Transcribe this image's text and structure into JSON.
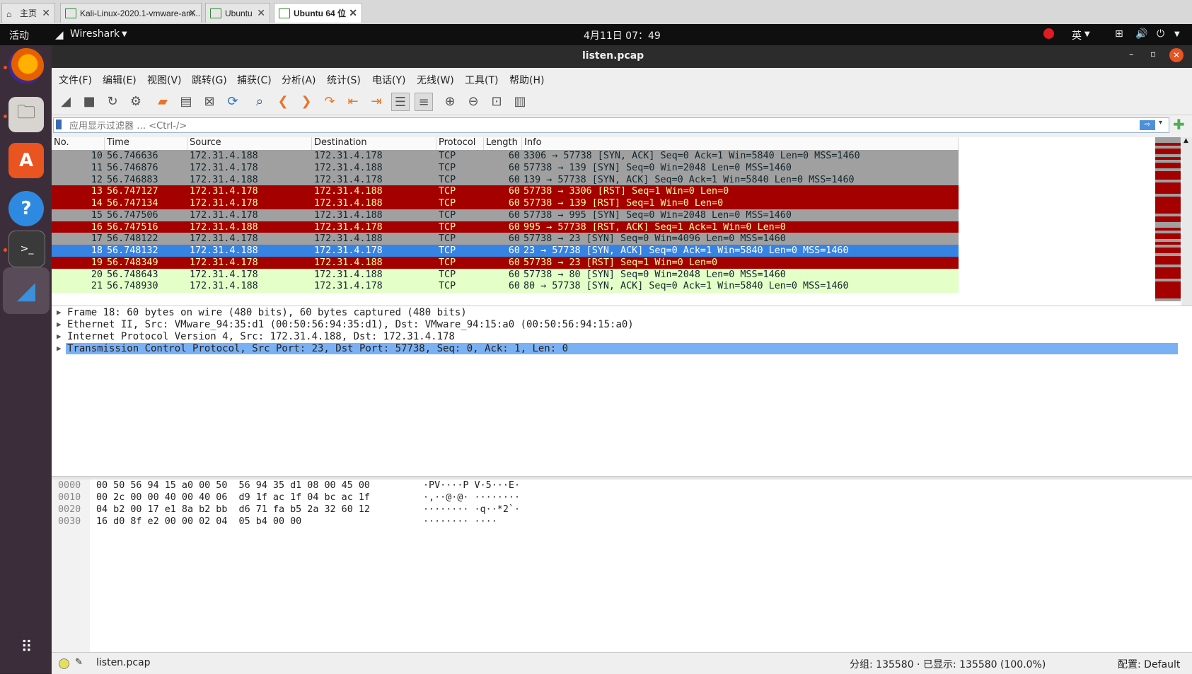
{
  "vm_tabs": [
    {
      "label": "主页",
      "icon": "home-icon"
    },
    {
      "label": "Kali-Linux-2020.1-vmware-am...",
      "icon": "vm-icon"
    },
    {
      "label": "Ubuntu",
      "icon": "vm-icon"
    },
    {
      "label": "Ubuntu 64 位",
      "icon": "vm-icon"
    }
  ],
  "topbar": {
    "activities": "活动",
    "app_name": "Wireshark",
    "clock": "4月11日 07：49",
    "input_method": "英"
  },
  "window": {
    "title": "listen.pcap"
  },
  "menu": [
    "文件(F)",
    "编辑(E)",
    "视图(V)",
    "跳转(G)",
    "捕获(C)",
    "分析(A)",
    "统计(S)",
    "电话(Y)",
    "无线(W)",
    "工具(T)",
    "帮助(H)"
  ],
  "filter": {
    "placeholder": "应用显示过滤器 … <Ctrl-/>"
  },
  "columns": [
    "No.",
    "Time",
    "Source",
    "Destination",
    "Protocol",
    "Length",
    "Info"
  ],
  "packets": [
    {
      "no": "10",
      "time": "56.746636",
      "src": "172.31.4.188",
      "dst": "172.31.4.178",
      "proto": "TCP",
      "len": "60",
      "info": "3306 → 57738 [SYN, ACK] Seq=0 Ack=1 Win=5840 Len=0 MSS=1460",
      "style": "gray"
    },
    {
      "no": "11",
      "time": "56.746876",
      "src": "172.31.4.178",
      "dst": "172.31.4.188",
      "proto": "TCP",
      "len": "60",
      "info": "57738 → 139 [SYN] Seq=0 Win=2048 Len=0 MSS=1460",
      "style": "gray"
    },
    {
      "no": "12",
      "time": "56.746883",
      "src": "172.31.4.188",
      "dst": "172.31.4.178",
      "proto": "TCP",
      "len": "60",
      "info": "139 → 57738 [SYN, ACK] Seq=0 Ack=1 Win=5840 Len=0 MSS=1460",
      "style": "gray"
    },
    {
      "no": "13",
      "time": "56.747127",
      "src": "172.31.4.178",
      "dst": "172.31.4.188",
      "proto": "TCP",
      "len": "60",
      "info": "57738 → 3306 [RST] Seq=1 Win=0 Len=0",
      "style": "red"
    },
    {
      "no": "14",
      "time": "56.747134",
      "src": "172.31.4.178",
      "dst": "172.31.4.188",
      "proto": "TCP",
      "len": "60",
      "info": "57738 → 139 [RST] Seq=1 Win=0 Len=0",
      "style": "red"
    },
    {
      "no": "15",
      "time": "56.747506",
      "src": "172.31.4.178",
      "dst": "172.31.4.188",
      "proto": "TCP",
      "len": "60",
      "info": "57738 → 995 [SYN] Seq=0 Win=2048 Len=0 MSS=1460",
      "style": "gray"
    },
    {
      "no": "16",
      "time": "56.747516",
      "src": "172.31.4.188",
      "dst": "172.31.4.178",
      "proto": "TCP",
      "len": "60",
      "info": "995 → 57738 [RST, ACK] Seq=1 Ack=1 Win=0 Len=0",
      "style": "red"
    },
    {
      "no": "17",
      "time": "56.748122",
      "src": "172.31.4.178",
      "dst": "172.31.4.188",
      "proto": "TCP",
      "len": "60",
      "info": "57738 → 23 [SYN] Seq=0 Win=4096 Len=0 MSS=1460",
      "style": "gray"
    },
    {
      "no": "18",
      "time": "56.748132",
      "src": "172.31.4.188",
      "dst": "172.31.4.178",
      "proto": "TCP",
      "len": "60",
      "info": "23 → 57738 [SYN, ACK] Seq=0 Ack=1 Win=5840 Len=0 MSS=1460",
      "style": "selected"
    },
    {
      "no": "19",
      "time": "56.748349",
      "src": "172.31.4.178",
      "dst": "172.31.4.188",
      "proto": "TCP",
      "len": "60",
      "info": "57738 → 23 [RST] Seq=1 Win=0 Len=0",
      "style": "red"
    },
    {
      "no": "20",
      "time": "56.748643",
      "src": "172.31.4.178",
      "dst": "172.31.4.188",
      "proto": "TCP",
      "len": "60",
      "info": "57738 → 80 [SYN] Seq=0 Win=2048 Len=0 MSS=1460",
      "style": "green"
    },
    {
      "no": "21",
      "time": "56.748930",
      "src": "172.31.4.188",
      "dst": "172.31.4.178",
      "proto": "TCP",
      "len": "60",
      "info": "80 → 57738 [SYN, ACK] Seq=0 Ack=1 Win=5840 Len=0 MSS=1460",
      "style": "green"
    }
  ],
  "row_styles": {
    "gray": {
      "bg": "#a0a0a0",
      "fg": "#12272e"
    },
    "red": {
      "bg": "#a40000",
      "fg": "#fffc9c"
    },
    "selected": {
      "bg": "#3584e4",
      "fg": "#ffffff"
    },
    "green": {
      "bg": "#e4ffc7",
      "fg": "#12272e"
    }
  },
  "details": [
    {
      "text": "Frame 18: 60 bytes on wire (480 bits), 60 bytes captured (480 bits)",
      "selected": false
    },
    {
      "text": "Ethernet II, Src: VMware_94:35:d1 (00:50:56:94:35:d1), Dst: VMware_94:15:a0 (00:50:56:94:15:a0)",
      "selected": false
    },
    {
      "text": "Internet Protocol Version 4, Src: 172.31.4.188, Dst: 172.31.4.178",
      "selected": false
    },
    {
      "text": "Transmission Control Protocol, Src Port: 23, Dst Port: 57738, Seq: 0, Ack: 1, Len: 0",
      "selected": true
    }
  ],
  "hex": [
    {
      "offset": "0000",
      "bytes": "00 50 56 94 15 a0 00 50  56 94 35 d1 08 00 45 00",
      "ascii": "·PV····P V·5···E·"
    },
    {
      "offset": "0010",
      "bytes": "00 2c 00 00 40 00 40 06  d9 1f ac 1f 04 bc ac 1f",
      "ascii": "·,··@·@· ········"
    },
    {
      "offset": "0020",
      "bytes": "04 b2 00 17 e1 8a b2 bb  d6 71 fa b5 2a 32 60 12",
      "ascii": "········ ·q··*2`·"
    },
    {
      "offset": "0030",
      "bytes": "16 d0 8f e2 00 00 02 04  05 b4 00 00",
      "ascii": "········ ····"
    }
  ],
  "status": {
    "file": "listen.pcap",
    "packets": "分组: 135580 · 已显示: 135580 (100.0%)",
    "profile": "配置: Default"
  }
}
